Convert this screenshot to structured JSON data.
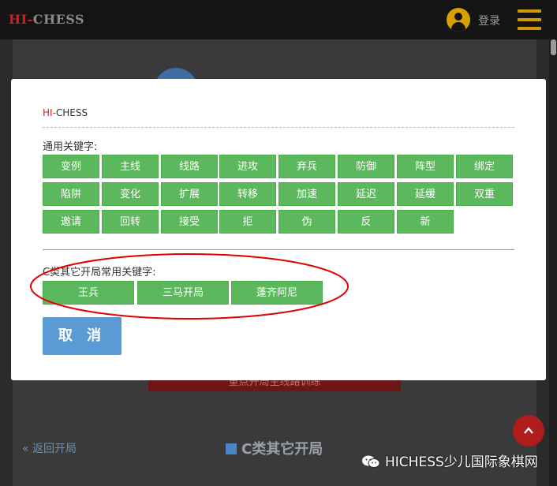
{
  "header": {
    "brand_hi": "HI-",
    "brand_rest": "CHESS",
    "login_label": "登录",
    "menu_icon": "hamburger-icon",
    "avatar_icon": "user-avatar-icon"
  },
  "background": {
    "banner_text": "重点开局主线路训练",
    "back_label": "返回开局",
    "back_icon": "double-chevron-left-icon",
    "page_title": "C类其它开局",
    "scroll_top_icon": "chevron-up-icon"
  },
  "modal": {
    "brand_hi": "HI-",
    "brand_rest": "CHESS",
    "general_label": "通用关键字:",
    "general_keywords": [
      "变例",
      "主线",
      "线路",
      "进攻",
      "弃兵",
      "防御",
      "阵型",
      "绑定",
      "陷阱",
      "变化",
      "扩展",
      "转移",
      "加速",
      "延迟",
      "延缓",
      "双重",
      "邀请",
      "回转",
      "接受",
      "拒",
      "伪",
      "反",
      "新"
    ],
    "c_label": "C类其它开局常用关键字:",
    "c_keywords": [
      "王兵",
      "三马开局",
      "蓬齐阿尼"
    ],
    "cancel_label": "取 消"
  },
  "watermark": {
    "text": "HICHESS少儿国际象棋网",
    "icon": "wechat-icon"
  },
  "colors": {
    "keyword_green": "#5cb85c",
    "cancel_blue": "#5b9bd5",
    "brand_red": "#e01919",
    "accent_gold": "#d19a00",
    "annotation_red": "#e00000"
  }
}
